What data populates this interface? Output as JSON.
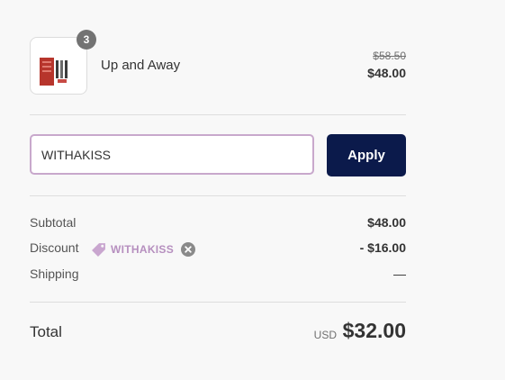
{
  "product": {
    "quantity": "3",
    "name": "Up and Away",
    "original_price": "$58.50",
    "price": "$48.00"
  },
  "discount_form": {
    "code_value": "WITHAKISS",
    "apply_label": "Apply"
  },
  "summary": {
    "subtotal_label": "Subtotal",
    "subtotal_value": "$48.00",
    "discount_label": "Discount",
    "discount_code": "WITHAKISS",
    "discount_value": "- $16.00",
    "shipping_label": "Shipping",
    "shipping_value": "—"
  },
  "total": {
    "label": "Total",
    "currency": "USD",
    "value": "$32.00"
  },
  "colors": {
    "button_bg": "#0b1a4b",
    "input_border": "#c8a8cc",
    "discount_tag": "#b68fbf"
  }
}
